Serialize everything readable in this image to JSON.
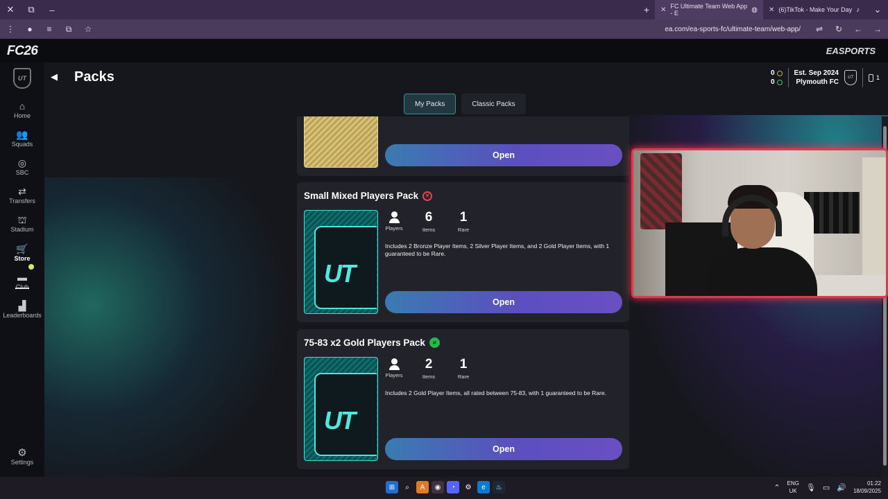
{
  "browser": {
    "tabs": [
      {
        "title": "FC Ultimate Team Web App - E",
        "active": true
      },
      {
        "title": "(6)TikTok - Make Your Day",
        "active": false
      }
    ],
    "url": "ea.com/ea-sports-fc/ultimate-team/web-app/"
  },
  "header": {
    "logo": "FC26",
    "publisher": "EASPORTS"
  },
  "sidebar": {
    "items": [
      {
        "label": "Home",
        "icon": "home-icon",
        "glyph": "⌂"
      },
      {
        "label": "Squads",
        "icon": "squads-icon",
        "glyph": "👥"
      },
      {
        "label": "SBC",
        "icon": "sbc-icon",
        "glyph": "◎"
      },
      {
        "label": "Transfers",
        "icon": "transfers-icon",
        "glyph": "⇄"
      },
      {
        "label": "Stadium",
        "icon": "stadium-icon",
        "glyph": "⛫"
      },
      {
        "label": "Store",
        "icon": "cart-icon",
        "glyph": "🛒"
      },
      {
        "label": "Club",
        "icon": "club-icon",
        "glyph": "▬"
      },
      {
        "label": "Leaderboards",
        "icon": "leaderboards-icon",
        "glyph": "▟"
      }
    ],
    "active": "Store",
    "settings_label": "Settings"
  },
  "page": {
    "title": "Packs"
  },
  "club": {
    "coins": "0",
    "points": "0",
    "established": "Est. Sep 2024",
    "name": "Plymouth FC",
    "notifications": "1"
  },
  "tabs": [
    {
      "label": "My Packs",
      "selected": true
    },
    {
      "label": "Classic Packs",
      "selected": false
    }
  ],
  "packs": [
    {
      "title": "",
      "open_label": "Open"
    },
    {
      "title": "Small Mixed Players Pack",
      "stats": [
        {
          "label": "Players"
        },
        {
          "value": "6",
          "label": "Items"
        },
        {
          "value": "1",
          "label": "Rare"
        }
      ],
      "description": "Includes 2 Bronze Player Items, 2 Silver Player Items, and 2 Gold Player Items, with 1 guaranteed to be Rare.",
      "open_label": "Open"
    },
    {
      "title": "75-83 x2 Gold Players Pack",
      "stats": [
        {
          "label": "Players"
        },
        {
          "value": "2",
          "label": "Items"
        },
        {
          "value": "1",
          "label": "Rare"
        }
      ],
      "description": "Includes 2 Gold Player Items, all rated between 75-83, with 1 guaranteed to be Rare.",
      "open_label": "Open"
    }
  ],
  "taskbar": {
    "lang_top": "ENG",
    "lang_bottom": "UK",
    "time": "01:22",
    "date": "18/09/2025"
  },
  "colors": {
    "accent_teal": "#3b8f8f",
    "open_button_start": "#3a7bb0",
    "open_button_end": "#6a4fc2",
    "webcam_border": "#e03a4a"
  }
}
